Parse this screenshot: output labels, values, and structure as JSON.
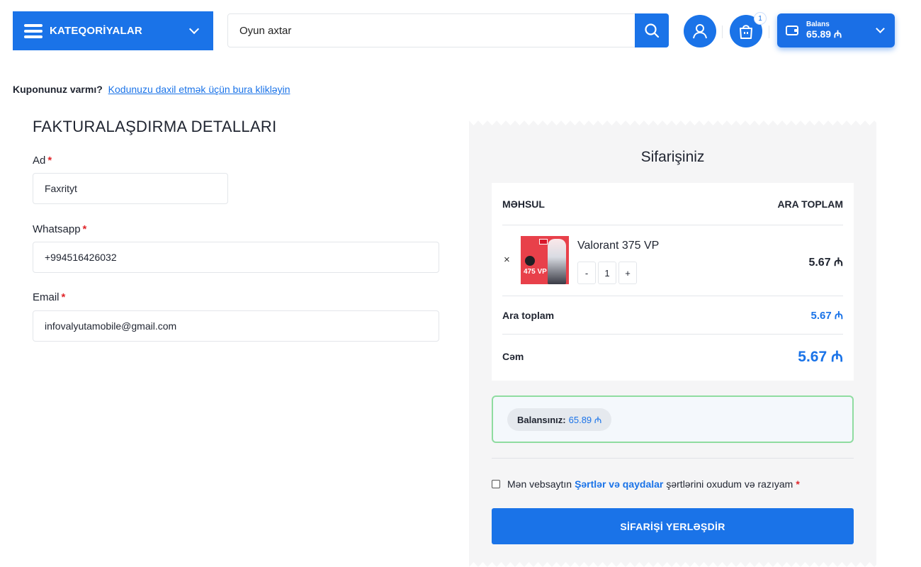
{
  "header": {
    "categories_label": "KATEQORİYALAR",
    "search_placeholder": "Oyun axtar",
    "cart_count": "1",
    "balance_label": "Balans",
    "balance_value": "65.89 ₼"
  },
  "coupon": {
    "question": "Kuponunuz varmı?",
    "link": "Kodunuzu daxil etmək üçün bura klikləyin"
  },
  "billing": {
    "title": "FAKTURALAŞDIRMA DETALLARI",
    "fields": [
      {
        "label": "Ad",
        "required": "*",
        "value": "Faxrityt"
      },
      {
        "label": "Whatsapp",
        "required": "*",
        "value": "+994516426032"
      },
      {
        "label": "Email",
        "required": "*",
        "value": "infovalyutamobile@gmail.com"
      }
    ]
  },
  "order": {
    "title": "Sifarişiniz",
    "col_product": "MƏHSUL",
    "col_subtotal": "ARA TOPLAM",
    "item": {
      "remove": "×",
      "name": "Valorant 375 VP",
      "thumb_label": "475 VP",
      "qty_minus": "-",
      "qty": "1",
      "qty_plus": "+",
      "price": "5.67 ₼"
    },
    "subtotal_label": "Ara toplam",
    "subtotal_value": "5.67 ₼",
    "total_label": "Cəm",
    "total_value": "5.67 ₼",
    "balance_key": "Balansınız:",
    "balance_value": "65.89 ₼",
    "terms_prefix": "Mən vebsaytın",
    "terms_link": "Şərtlər və qaydalar",
    "terms_suffix": "şərtlərini oxudum və razıyam",
    "terms_required": "*",
    "place_order": "SİFARİŞİ YERLƏŞDİR"
  },
  "colors": {
    "accent": "#1a73e8",
    "required": "#e0262b",
    "success_border": "#8fdca0"
  }
}
